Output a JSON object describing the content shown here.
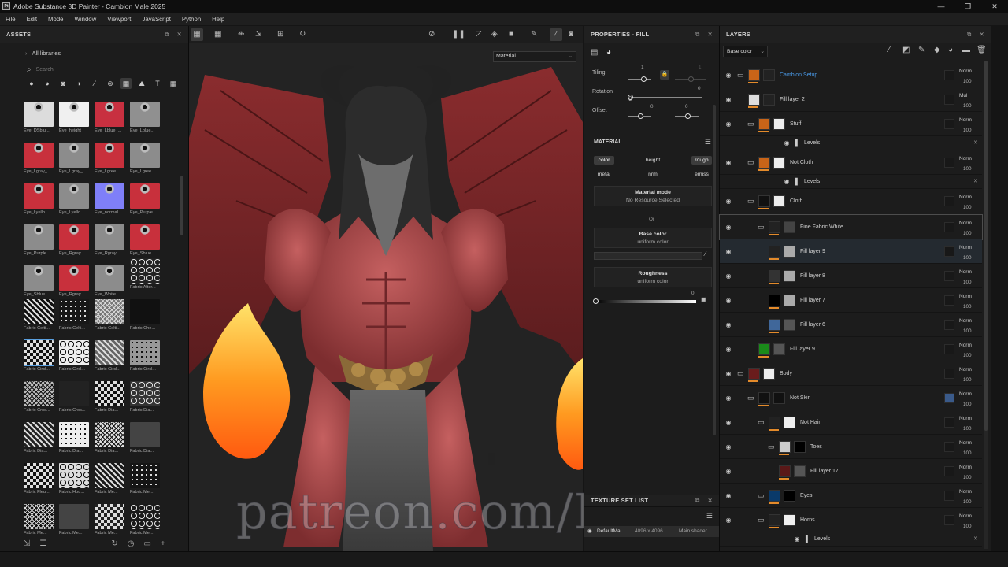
{
  "window": {
    "title": "Adobe Substance 3D Painter - Cambion Male 2025",
    "logo_text": "Pt",
    "minimize": "—",
    "maximize": "❐",
    "close": "✕"
  },
  "menu": [
    "File",
    "Edit",
    "Mode",
    "Window",
    "Viewport",
    "JavaScript",
    "Python",
    "Help"
  ],
  "assets": {
    "title": "ASSETS",
    "libraries": "All libraries",
    "search_placeholder": "Search",
    "items": [
      {
        "label": "Eye_DSblu...",
        "color": "#dcdcdc"
      },
      {
        "label": "Eye_height",
        "color": "#f0f0f0"
      },
      {
        "label": "Eye_Lblue_...",
        "color": "#c83040"
      },
      {
        "label": "Eye_Lblue...",
        "color": "#909090"
      },
      {
        "label": "Eye_Lgray_...",
        "color": "#c8303c"
      },
      {
        "label": "Eye_Lgray_...",
        "color": "#8c8c8c"
      },
      {
        "label": "Eye_Lgree...",
        "color": "#c8303c"
      },
      {
        "label": "Eye_Lgree...",
        "color": "#8c8c8c"
      },
      {
        "label": "Eye_Lyello...",
        "color": "#c8303c"
      },
      {
        "label": "Eye_Lyello...",
        "color": "#8c8c8c"
      },
      {
        "label": "Eye_normal",
        "color": "#7f7ff8"
      },
      {
        "label": "Eye_Purple...",
        "color": "#c8303c"
      },
      {
        "label": "Eye_Purple...",
        "color": "#8c8c8c"
      },
      {
        "label": "Eye_Rgray...",
        "color": "#c8303c"
      },
      {
        "label": "Eye_Rgray...",
        "color": "#8c8c8c"
      },
      {
        "label": "Eye_Sblue...",
        "color": "#c8303c"
      },
      {
        "label": "Eye_Sblue...",
        "color": "#8c8c8c"
      },
      {
        "label": "Eye_Rgray...",
        "color": "#c8303c"
      },
      {
        "label": "Eye_White...",
        "color": "#8c8c8c"
      },
      {
        "label": "Fabric Alter...",
        "color": "#222222"
      },
      {
        "label": "Fabric Celti...",
        "color": "#101010"
      },
      {
        "label": "Fabric Celti...",
        "color": "#181818"
      },
      {
        "label": "Fabric Celti...",
        "color": "#777777"
      },
      {
        "label": "Fabric Che...",
        "color": "#111111"
      },
      {
        "label": "Fabric Circl...",
        "color": "#111111"
      },
      {
        "label": "Fabric Circl...",
        "color": "#eeeeee"
      },
      {
        "label": "Fabric Circl...",
        "color": "#666666"
      },
      {
        "label": "Fabric Circl...",
        "color": "#999999"
      },
      {
        "label": "Fabric Cros...",
        "color": "#bbbbbb"
      },
      {
        "label": "Fabric Cros...",
        "color": "#222222"
      },
      {
        "label": "Fabric Dia...",
        "color": "#dddddd"
      },
      {
        "label": "Fabric Dia...",
        "color": "#333333"
      },
      {
        "label": "Fabric Dia...",
        "color": "#222222"
      },
      {
        "label": "Fabric Dia...",
        "color": "#eeeeee"
      },
      {
        "label": "Fabric Dia...",
        "color": "#dddddd"
      },
      {
        "label": "Fabric Dia...",
        "color": "#444444"
      },
      {
        "label": "Fabric Fleu...",
        "color": "#111111"
      },
      {
        "label": "Fabric Hou...",
        "color": "#dddddd"
      },
      {
        "label": "Fabric Me...",
        "color": "#1a1a1a"
      },
      {
        "label": "Fabric Me...",
        "color": "#151515"
      },
      {
        "label": "Fabric Me...",
        "color": "#101010"
      },
      {
        "label": "Fabric Me...",
        "color": "#444444"
      },
      {
        "label": "Fabric Me...",
        "color": "#222222"
      },
      {
        "label": "Fabric Me...",
        "color": "#1a1a1a"
      }
    ]
  },
  "viewport": {
    "material_select": "Material",
    "watermark": "patreon.com/Lodaim"
  },
  "properties": {
    "title": "PROPERTIES - FILL",
    "tiling_label": "Tiling",
    "tiling_value": "1",
    "tiling_value2": "1",
    "rotation_label": "Rotation",
    "rotation_value": "0",
    "rotation_value2": "0",
    "offset_label": "Offset",
    "offset_value": "0",
    "offset_value2": "0",
    "material_title": "MATERIAL",
    "channels": [
      "color",
      "height",
      "rough",
      "metal",
      "nrm",
      "emiss"
    ],
    "material_mode_title": "Material mode",
    "material_mode_value": "No Resource Selected",
    "or_text": "Or",
    "base_color_title": "Base color",
    "base_color_value": "uniform color",
    "roughness_title": "Roughness",
    "roughness_value": "uniform color",
    "roughness_number": "0"
  },
  "texture_set_list": {
    "title": "TEXTURE SET LIST",
    "name": "DefaultMa...",
    "size": "4096 x 4096",
    "shader": "Main shader"
  },
  "layers": {
    "title": "LAYERS",
    "channel_select": "Base color",
    "rows": [
      {
        "name": "Cambion Setup",
        "blend": "Norm",
        "opacity": "100",
        "accent": "#4a9ae8"
      },
      {
        "name": "Fill layer 2",
        "blend": "Mul",
        "opacity": "100"
      },
      {
        "name": "Stuff",
        "blend": "Norm",
        "opacity": "100"
      },
      {
        "name": "Levels"
      },
      {
        "name": "Not Cloth",
        "blend": "Norm",
        "opacity": "100"
      },
      {
        "name": "Levels"
      },
      {
        "name": "Cloth",
        "blend": "Norm",
        "opacity": "100"
      },
      {
        "name": "Fine Fabric White",
        "blend": "Norm",
        "opacity": "100"
      },
      {
        "name": "Fill layer 9",
        "blend": "Norm",
        "opacity": "100"
      },
      {
        "name": "Fill layer 8",
        "blend": "Norm",
        "opacity": "100"
      },
      {
        "name": "Fill layer 7",
        "blend": "Norm",
        "opacity": "100"
      },
      {
        "name": "Fill layer 6",
        "blend": "Norm",
        "opacity": "100"
      },
      {
        "name": "Fill layer 9",
        "blend": "Norm",
        "opacity": "100"
      },
      {
        "name": "Body",
        "blend": "Norm",
        "opacity": "100"
      },
      {
        "name": "Not Skin",
        "blend": "Norm",
        "opacity": "100"
      },
      {
        "name": "Not Hair",
        "blend": "Norm",
        "opacity": "100"
      },
      {
        "name": "Toes",
        "blend": "Norm",
        "opacity": "100"
      },
      {
        "name": "Fill layer 17",
        "blend": "Norm",
        "opacity": "100"
      },
      {
        "name": "Eyes",
        "blend": "Norm",
        "opacity": "100"
      },
      {
        "name": "Horns",
        "blend": "Norm",
        "opacity": "100"
      },
      {
        "name": "Levels"
      }
    ]
  }
}
